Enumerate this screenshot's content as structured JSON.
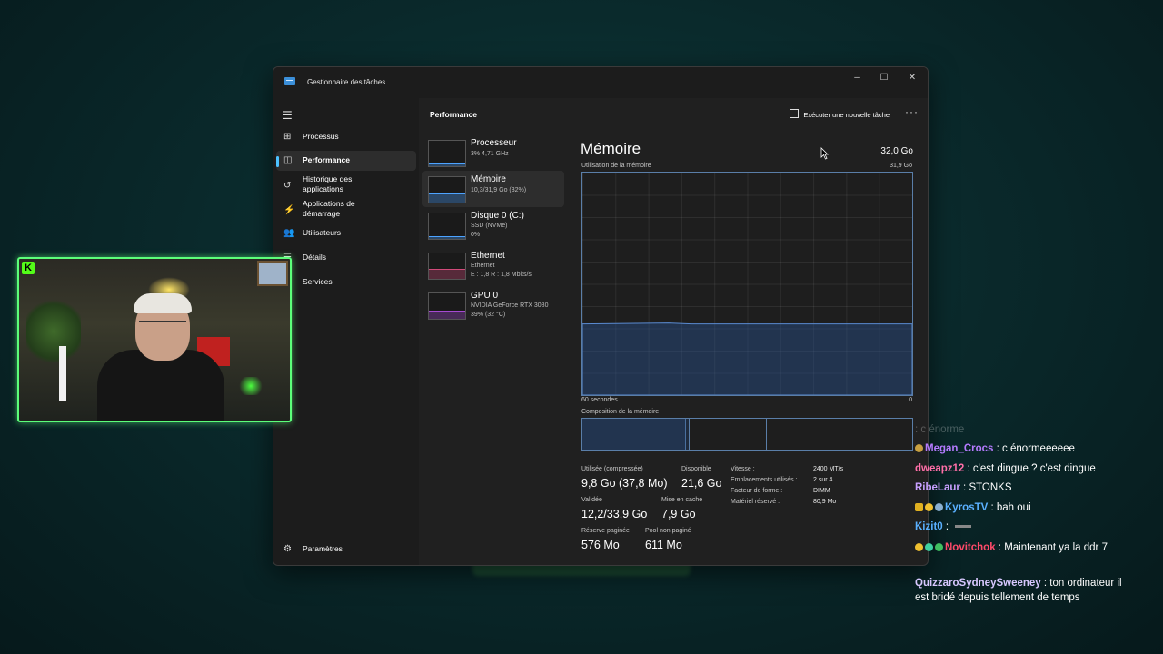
{
  "window": {
    "title": "Gestionnaire des tâches",
    "controls": {
      "minimize": "–",
      "maximize": "☐",
      "close": "✕"
    }
  },
  "sidebar": {
    "items": [
      {
        "label": "Processus",
        "icon": "grid-icon",
        "glyph": "⊞"
      },
      {
        "label": "Performance",
        "icon": "performance-icon",
        "glyph": "◫"
      },
      {
        "label": "Historique des\napplications",
        "icon": "history-icon",
        "glyph": "↺"
      },
      {
        "label": "Applications de\ndémarrage",
        "icon": "startup-icon",
        "glyph": "⚡"
      },
      {
        "label": "Utilisateurs",
        "icon": "users-icon",
        "glyph": "👥"
      },
      {
        "label": "Détails",
        "icon": "details-icon",
        "glyph": "☰"
      },
      {
        "label": "Services",
        "icon": "services-icon",
        "glyph": "⚙"
      }
    ],
    "settings_label": "Paramètres",
    "settings_glyph": "⚙"
  },
  "header": {
    "title": "Performance",
    "run_task": "Exécuter une nouvelle tâche",
    "more": "···"
  },
  "devices": [
    {
      "name": "Processeur",
      "line1": "3%  4,71 GHz",
      "line2": "",
      "color": "#4da3ff",
      "level": 0.05
    },
    {
      "name": "Mémoire",
      "line1": "10,3/31,9 Go (32%)",
      "line2": "",
      "color": "#4da3ff",
      "level": 0.32
    },
    {
      "name": "Disque 0 (C:)",
      "line1": "SSD (NVMe)",
      "line2": "0%",
      "color": "#4da3ff",
      "level": 0.0
    },
    {
      "name": "Ethernet",
      "line1": "Ethernet",
      "line2": "E : 1,8  R : 1,8 Mbits/s",
      "color": "#d24a7a",
      "level": 0.35
    },
    {
      "name": "GPU 0",
      "line1": "NVIDIA GeForce RTX 3080",
      "line2": "39% (32 °C)",
      "color": "#a64ad2",
      "level": 0.3
    }
  ],
  "memory": {
    "title": "Mémoire",
    "total": "32,0 Go",
    "usage_label": "Utilisation de la mémoire",
    "usage_max": "31,9 Go",
    "time_left": "60 secondes",
    "time_right": "0",
    "composition_label": "Composition de la mémoire",
    "usage_level": 0.32,
    "stats": {
      "used_label": "Utilisée (compressée)",
      "used_value": "9,8 Go (37,8 Mo)",
      "available_label": "Disponible",
      "available_value": "21,6 Go",
      "committed_label": "Validée",
      "committed_value": "12,2/33,9 Go",
      "cached_label": "Mise en cache",
      "cached_value": "7,9 Go",
      "paged_label": "Réserve paginée",
      "paged_value": "576 Mo",
      "nonpaged_label": "Pool non paginé",
      "nonpaged_value": "611 Mo"
    },
    "details": [
      {
        "key": "Vitesse :",
        "value": "2400 MT/s"
      },
      {
        "key": "Emplacements utilisés :",
        "value": "2 sur 4"
      },
      {
        "key": "Facteur de forme :",
        "value": "DIMM"
      },
      {
        "key": "Matériel réservé :",
        "value": "80,9 Mo"
      }
    ]
  },
  "webcam": {
    "logo": "K"
  },
  "chat": [
    {
      "user": "",
      "text": "c énorme",
      "color": "#888888",
      "faded": true
    },
    {
      "user": "Megan_Crocs",
      "text": "c énormeeeeee",
      "color": "#b57bff"
    },
    {
      "user": "dweapz12",
      "text": "c'est dingue ? c'est dingue",
      "color": "#ff6fa8"
    },
    {
      "user": "RibeLaur",
      "text": "STONKS",
      "color": "#c8a0ff"
    },
    {
      "user": "KyrosTV",
      "text": "bah oui",
      "color": "#5ab0ff"
    },
    {
      "user": "Kizit0",
      "text": "",
      "color": "#5ab0ff"
    },
    {
      "user": "Novitchok",
      "text": "Maintenant ya la ddr 7",
      "color": "#ff4a6a"
    },
    {
      "user": "QuizzaroSydneySweeney",
      "text": "ton ordinateur il est bridé depuis tellement de temps",
      "color": "#d8c8ff"
    }
  ]
}
